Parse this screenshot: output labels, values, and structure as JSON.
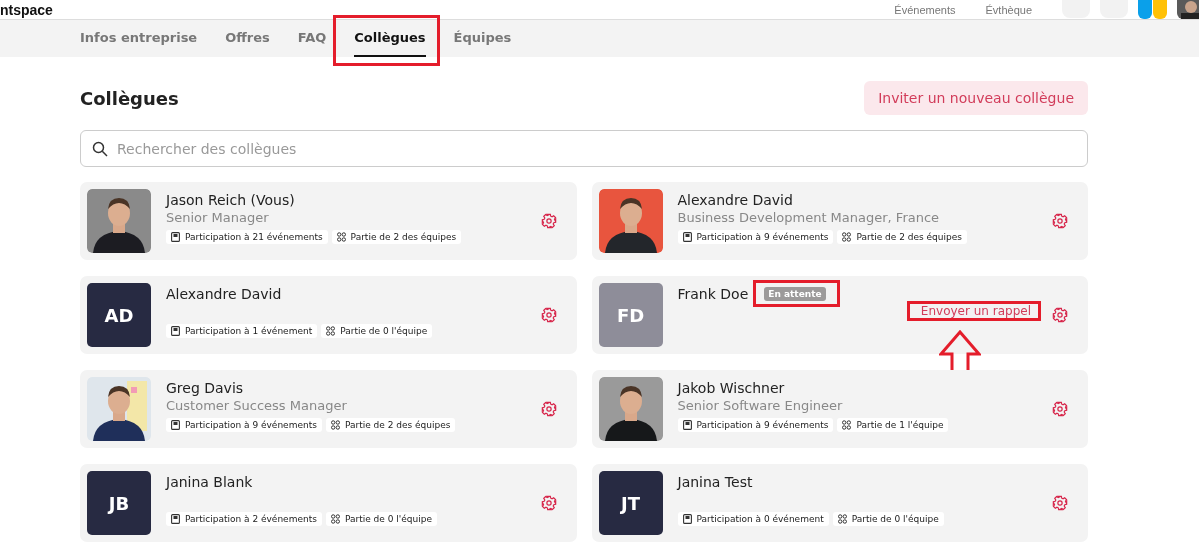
{
  "header": {
    "logo": "ntspace",
    "nav": [
      "Événements",
      "Évthèque"
    ]
  },
  "tabs": [
    {
      "label": "Infos entreprise",
      "selected": false,
      "highlighted": false
    },
    {
      "label": "Offres",
      "selected": false,
      "highlighted": false
    },
    {
      "label": "FAQ",
      "selected": false,
      "highlighted": false
    },
    {
      "label": "Collègues",
      "selected": true,
      "highlighted": true
    },
    {
      "label": "Équipes",
      "selected": false,
      "highlighted": false
    }
  ],
  "title": "Collègues",
  "invite_button": "Inviter un nouveau collègue",
  "search": {
    "placeholder": "Rechercher des collègues"
  },
  "colleagues": [
    {
      "name": "Jason Reich (Vous)",
      "role": "Senior Manager",
      "pending": false,
      "events": "Participation à 21 événements",
      "teams": "Partie de 2 des équipes"
    },
    {
      "name": "Alexandre David",
      "role": "Business Development Manager, France",
      "pending": false,
      "events": "Participation à 9 événements",
      "teams": "Partie de 2 des équipes"
    },
    {
      "name": "Alexandre David",
      "avatar": {
        "kind": "initials",
        "initials": "AD"
      },
      "pending": false,
      "events": "Participation à 1 événement",
      "teams": "Partie de 0 l'équipe"
    },
    {
      "name": "Frank Doe",
      "avatar": {
        "kind": "initials",
        "initials": "FD"
      },
      "pending": true,
      "badge": "En attente",
      "reminder": "Envoyer un rappel",
      "highlighted": true
    },
    {
      "name": "Greg Davis",
      "role": "Customer Success Manager",
      "pending": false,
      "events": "Participation à 9 événements",
      "teams": "Partie de 2 des équipes"
    },
    {
      "name": "Jakob Wischner",
      "role": "Senior Software Engineer",
      "pending": false,
      "events": "Participation à 9 événements",
      "teams": "Partie de 1 l'équipe"
    },
    {
      "name": "Janina Blank",
      "avatar": {
        "kind": "initials",
        "initials": "JB"
      },
      "pending": false,
      "events": "Participation à 2 événements",
      "teams": "Partie de 0 l'équipe"
    },
    {
      "name": "Janina Test",
      "avatar": {
        "kind": "initials",
        "initials": "JT"
      },
      "pending": false,
      "events": "Participation à 0 événement",
      "teams": "Partie de 0 l'équipe"
    }
  ]
}
